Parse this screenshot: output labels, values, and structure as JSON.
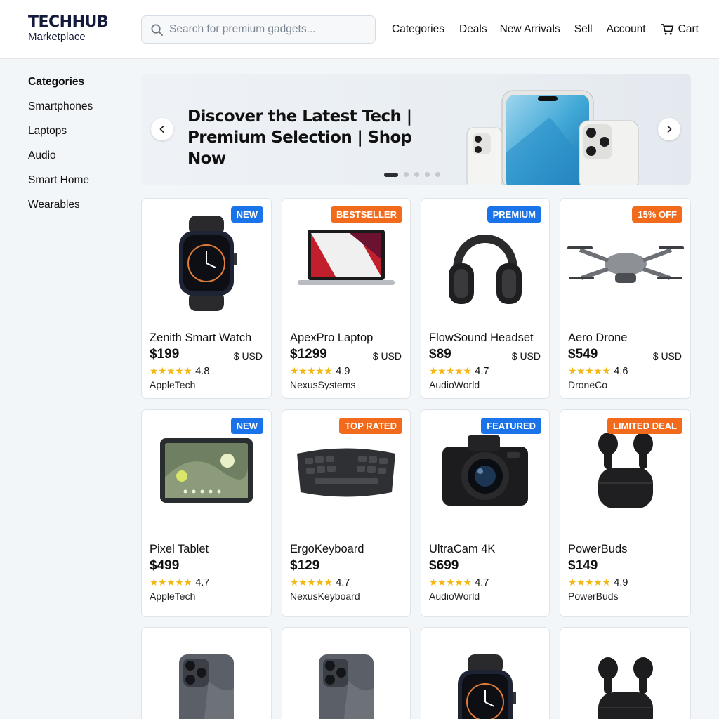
{
  "brand": {
    "title": "TECHHUB",
    "subtitle": "Marketplace"
  },
  "search": {
    "placeholder": "Search for premium gadgets..."
  },
  "nav": {
    "items": [
      "Categories",
      "Deals",
      "New Arrivals",
      "Sell",
      "Account"
    ],
    "cart_label": "Cart"
  },
  "sidebar": {
    "title": "Categories",
    "items": [
      "Smartphones",
      "Laptops",
      "Audio",
      "Smart Home",
      "Wearables"
    ]
  },
  "banner": {
    "line1": "Discover the Latest Tech |",
    "line2": "Premium Selection | Shop Now",
    "slides": 5,
    "active_slide": 1
  },
  "colors": {
    "new": "#1a73e8",
    "orange": "#f26a1b",
    "star": "#f2b711",
    "brand_dark": "#141a3a"
  },
  "products": [
    {
      "badge": "NEW",
      "badge_color": "blue",
      "name": "Zenith Smart Watch",
      "price": "$199",
      "currency": "$ USD",
      "stars": "★★★★★",
      "rating": "4.8",
      "brand": "AppleTech",
      "icon": "smartwatch-icon"
    },
    {
      "badge": "BESTSELLER",
      "badge_color": "orange",
      "name": "ApexPro Laptop",
      "price": "$1299",
      "currency": "$ USD",
      "stars": "★★★★★",
      "rating": "4.9",
      "brand": "NexusSystems",
      "icon": "laptop-icon"
    },
    {
      "badge": "PREMIUM",
      "badge_color": "blue",
      "name": "FlowSound Headset",
      "price": "$89",
      "currency": "$ USD",
      "stars": "★★★★★",
      "rating": "4.7",
      "brand": "AudioWorld",
      "icon": "headphones-icon"
    },
    {
      "badge": "15% OFF",
      "badge_color": "orange",
      "name": "Aero Drone",
      "price": "$549",
      "currency": "$ USD",
      "stars": "★★★★★",
      "rating": "4.6",
      "brand": "DroneCo",
      "icon": "drone-icon"
    },
    {
      "badge": "NEW",
      "badge_color": "blue",
      "name": "Pixel Tablet",
      "price": "$499",
      "currency": "",
      "stars": "★★★★★",
      "rating": "4.7",
      "brand": "AppleTech",
      "icon": "tablet-icon"
    },
    {
      "badge": "TOP RATED",
      "badge_color": "orange",
      "name": "ErgoKeyboard",
      "price": "$129",
      "currency": "",
      "stars": "★★★★★",
      "rating": "4.7",
      "brand": "NexusKeyboard",
      "icon": "keyboard-icon"
    },
    {
      "badge": "FEATURED",
      "badge_color": "blue",
      "name": "UltraCam 4K",
      "price": "$699",
      "currency": "",
      "stars": "★★★★★",
      "rating": "4.7",
      "brand": "AudioWorld",
      "icon": "camera-icon"
    },
    {
      "badge": "LIMITED DEAL",
      "badge_color": "orange",
      "name": "PowerBuds",
      "price": "$149",
      "currency": "",
      "stars": "★★★★★",
      "rating": "4.9",
      "brand": "PowerBuds",
      "icon": "earbuds-icon"
    },
    {
      "badge": "",
      "badge_color": "",
      "name": "",
      "price": "",
      "currency": "",
      "stars": "",
      "rating": "",
      "brand": "",
      "icon": "smartphone-icon"
    },
    {
      "badge": "",
      "badge_color": "",
      "name": "",
      "price": "",
      "currency": "",
      "stars": "",
      "rating": "",
      "brand": "",
      "icon": "smartphone-icon"
    },
    {
      "badge": "",
      "badge_color": "",
      "name": "",
      "price": "",
      "currency": "",
      "stars": "",
      "rating": "",
      "brand": "",
      "icon": "smartwatch-icon"
    },
    {
      "badge": "",
      "badge_color": "",
      "name": "",
      "price": "",
      "currency": "",
      "stars": "",
      "rating": "",
      "brand": "",
      "icon": "earbuds-icon"
    }
  ]
}
